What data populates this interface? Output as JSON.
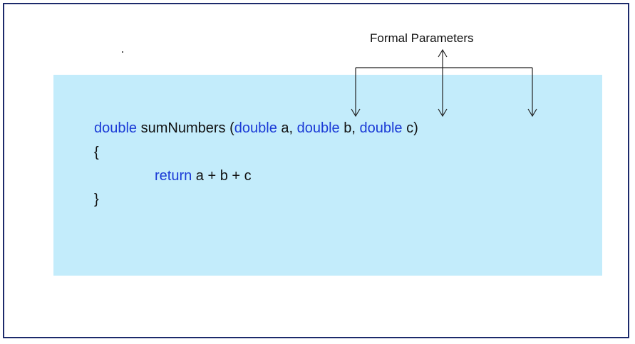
{
  "heading": "Formal Parameters",
  "code": {
    "line1": {
      "kw_return_type": "double",
      "fn_name": " sumNumbers (",
      "kw_p1": "double",
      "p1": " a, ",
      "kw_p2": "double",
      "p2": " b, ",
      "kw_p3": "double",
      "p3": " c)"
    },
    "line2": "{",
    "line3": {
      "kw_return": "return",
      "expr": " a + b + c"
    },
    "line4": "}"
  },
  "colors": {
    "keyword": "#1a3ad6",
    "text": "#111111",
    "code_background": "#c3ecfb",
    "border": "#1c2a6b"
  }
}
